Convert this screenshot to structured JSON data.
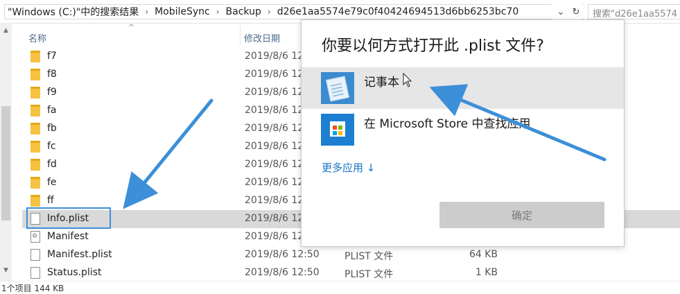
{
  "address_bar": {
    "crumbs": [
      "\"Windows (C:)\"中的搜索结果",
      "MobileSync",
      "Backup",
      "d26e1aa5574e79c0f40424694513d6bb6253bc70"
    ],
    "separator": "›",
    "dropdown_icon": "chevron-down-icon",
    "refresh_icon": "refresh-icon",
    "refresh_glyph": "↻",
    "dropdown_glyph": "⌄",
    "search_placeholder": "搜索\"d26e1aa5574"
  },
  "columns": {
    "name": "名称",
    "date": "修改日期",
    "sort_glyph": "^"
  },
  "rows": [
    {
      "name": "f7",
      "date": "2019/8/6 12",
      "type": "",
      "size": "",
      "icon": "folder"
    },
    {
      "name": "f8",
      "date": "2019/8/6 12",
      "type": "",
      "size": "",
      "icon": "folder"
    },
    {
      "name": "f9",
      "date": "2019/8/6 12",
      "type": "",
      "size": "",
      "icon": "folder"
    },
    {
      "name": "fa",
      "date": "2019/8/6 12",
      "type": "",
      "size": "",
      "icon": "folder"
    },
    {
      "name": "fb",
      "date": "2019/8/6 12",
      "type": "",
      "size": "",
      "icon": "folder"
    },
    {
      "name": "fc",
      "date": "2019/8/6 12",
      "type": "",
      "size": "",
      "icon": "folder"
    },
    {
      "name": "fd",
      "date": "2019/8/6 12",
      "type": "",
      "size": "",
      "icon": "folder"
    },
    {
      "name": "fe",
      "date": "2019/8/6 12",
      "type": "",
      "size": "",
      "icon": "folder"
    },
    {
      "name": "ff",
      "date": "2019/8/6 12",
      "type": "",
      "size": "",
      "icon": "folder"
    },
    {
      "name": "Info.plist",
      "date": "2019/8/6 12",
      "type": "",
      "size": "",
      "icon": "file"
    },
    {
      "name": "Manifest",
      "date": "2019/8/6 12",
      "type": "",
      "size": "",
      "icon": "file-gear"
    },
    {
      "name": "Manifest.plist",
      "date": "2019/8/6 12:50",
      "type": "PLIST 文件",
      "size": "64 KB",
      "icon": "file"
    },
    {
      "name": "Status.plist",
      "date": "2019/8/6 12:50",
      "type": "PLIST 文件",
      "size": "1 KB",
      "icon": "file"
    }
  ],
  "status_bar": {
    "text": "1个项目  144 KB"
  },
  "dialog": {
    "title": "你要以何方式打开此 .plist 文件?",
    "apps": [
      {
        "label": "记事本",
        "icon": "notepad-icon"
      },
      {
        "label": "在 Microsoft Store 中查找应用",
        "icon": "store-icon"
      }
    ],
    "more_apps": "更多应用 ↓",
    "ok_button": "确定",
    "colors": {
      "accent": "#1a73c8",
      "hover_bg": "#e6e6e6",
      "button_disabled": "#cccccc",
      "annotation_arrow": "#3c8fd8"
    }
  },
  "annotations": {
    "arrow_icon": "arrow-annotation"
  }
}
